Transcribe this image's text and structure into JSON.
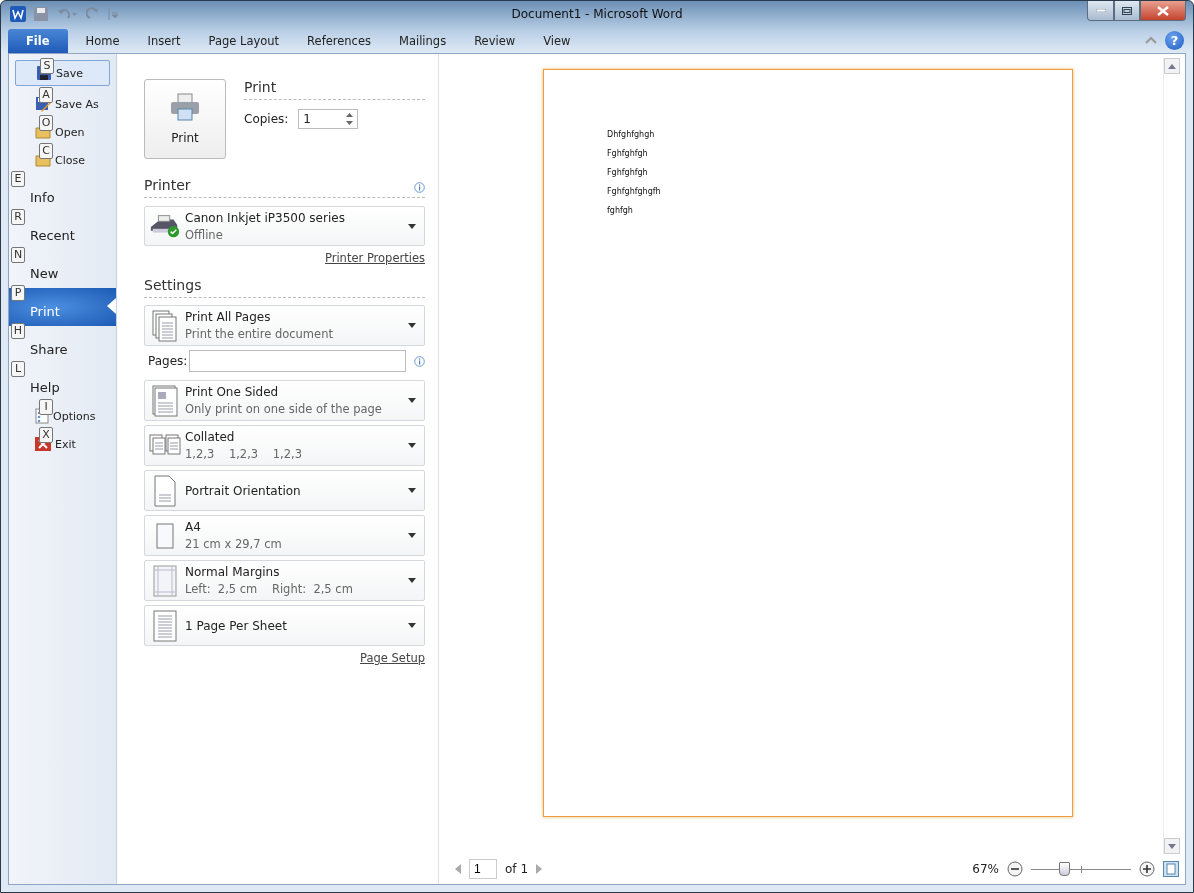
{
  "window": {
    "title": "Document1  -  Microsoft Word"
  },
  "ribbon_tabs": [
    {
      "label": "File",
      "selected": true
    },
    {
      "label": "Home",
      "selected": false
    },
    {
      "label": "Insert",
      "selected": false
    },
    {
      "label": "Page Layout",
      "selected": false
    },
    {
      "label": "References",
      "selected": false
    },
    {
      "label": "Mailings",
      "selected": false
    },
    {
      "label": "Review",
      "selected": false
    },
    {
      "label": "View",
      "selected": false
    }
  ],
  "help_button": "?",
  "backstage_menu": [
    {
      "kind": "command",
      "key_tip": "S",
      "label": "Save",
      "selected": false,
      "focused": true
    },
    {
      "kind": "command",
      "key_tip": "A",
      "label": "Save As",
      "selected": false,
      "focused": false
    },
    {
      "kind": "command",
      "key_tip": "O",
      "label": "Open",
      "selected": false,
      "focused": false
    },
    {
      "kind": "command",
      "key_tip": "C",
      "label": "Close",
      "selected": false,
      "focused": false
    },
    {
      "kind": "section",
      "key_tip": "E",
      "label": "Info",
      "selected": false,
      "focused": false
    },
    {
      "kind": "section",
      "key_tip": "R",
      "label": "Recent",
      "selected": false,
      "focused": false
    },
    {
      "kind": "section",
      "key_tip": "N",
      "label": "New",
      "selected": false,
      "focused": false
    },
    {
      "kind": "section",
      "key_tip": "P",
      "label": "Print",
      "selected": true,
      "focused": false
    },
    {
      "kind": "section",
      "key_tip": "H",
      "label": "Share",
      "selected": false,
      "focused": false
    },
    {
      "kind": "section",
      "key_tip": "L",
      "label": "Help",
      "selected": false,
      "focused": false
    },
    {
      "kind": "command",
      "key_tip": "I",
      "label": "Options",
      "selected": false,
      "focused": false
    },
    {
      "kind": "command",
      "key_tip": "X",
      "label": "Exit",
      "selected": false,
      "focused": false
    }
  ],
  "print": {
    "heading": "Print",
    "button": "Print",
    "copies_label": "Copies:",
    "copies_value": "1"
  },
  "printer": {
    "heading": "Printer",
    "name": "Canon Inkjet iP3500 series",
    "status": "Offline",
    "link": "Printer Properties"
  },
  "settings": {
    "heading": "Settings",
    "pages_label": "Pages:",
    "link": "Page Setup",
    "options": [
      {
        "title": "Print All Pages",
        "subtitle": "Print the entire document"
      },
      {
        "title": "Print One Sided",
        "subtitle": "Only print on one side of the page"
      },
      {
        "title": "Collated",
        "subtitle": "1,2,3    1,2,3    1,2,3"
      },
      {
        "title": "Portrait Orientation"
      },
      {
        "title": "A4",
        "subtitle": "21 cm x 29,7 cm"
      },
      {
        "title": "Normal Margins",
        "subtitle": "Left:  2,5 cm    Right:  2,5 cm"
      },
      {
        "title": "1 Page Per Sheet"
      }
    ]
  },
  "preview": {
    "lines": [
      "Dhfghfghgh",
      "Fghfghfgh",
      "Fghfghfgh",
      "Fghfghfghgfh",
      "fghfgh"
    ]
  },
  "status_bar": {
    "page": "1",
    "page_total": "of 1",
    "zoom": "67%",
    "zoom_slider": {
      "level": 0.33
    }
  }
}
